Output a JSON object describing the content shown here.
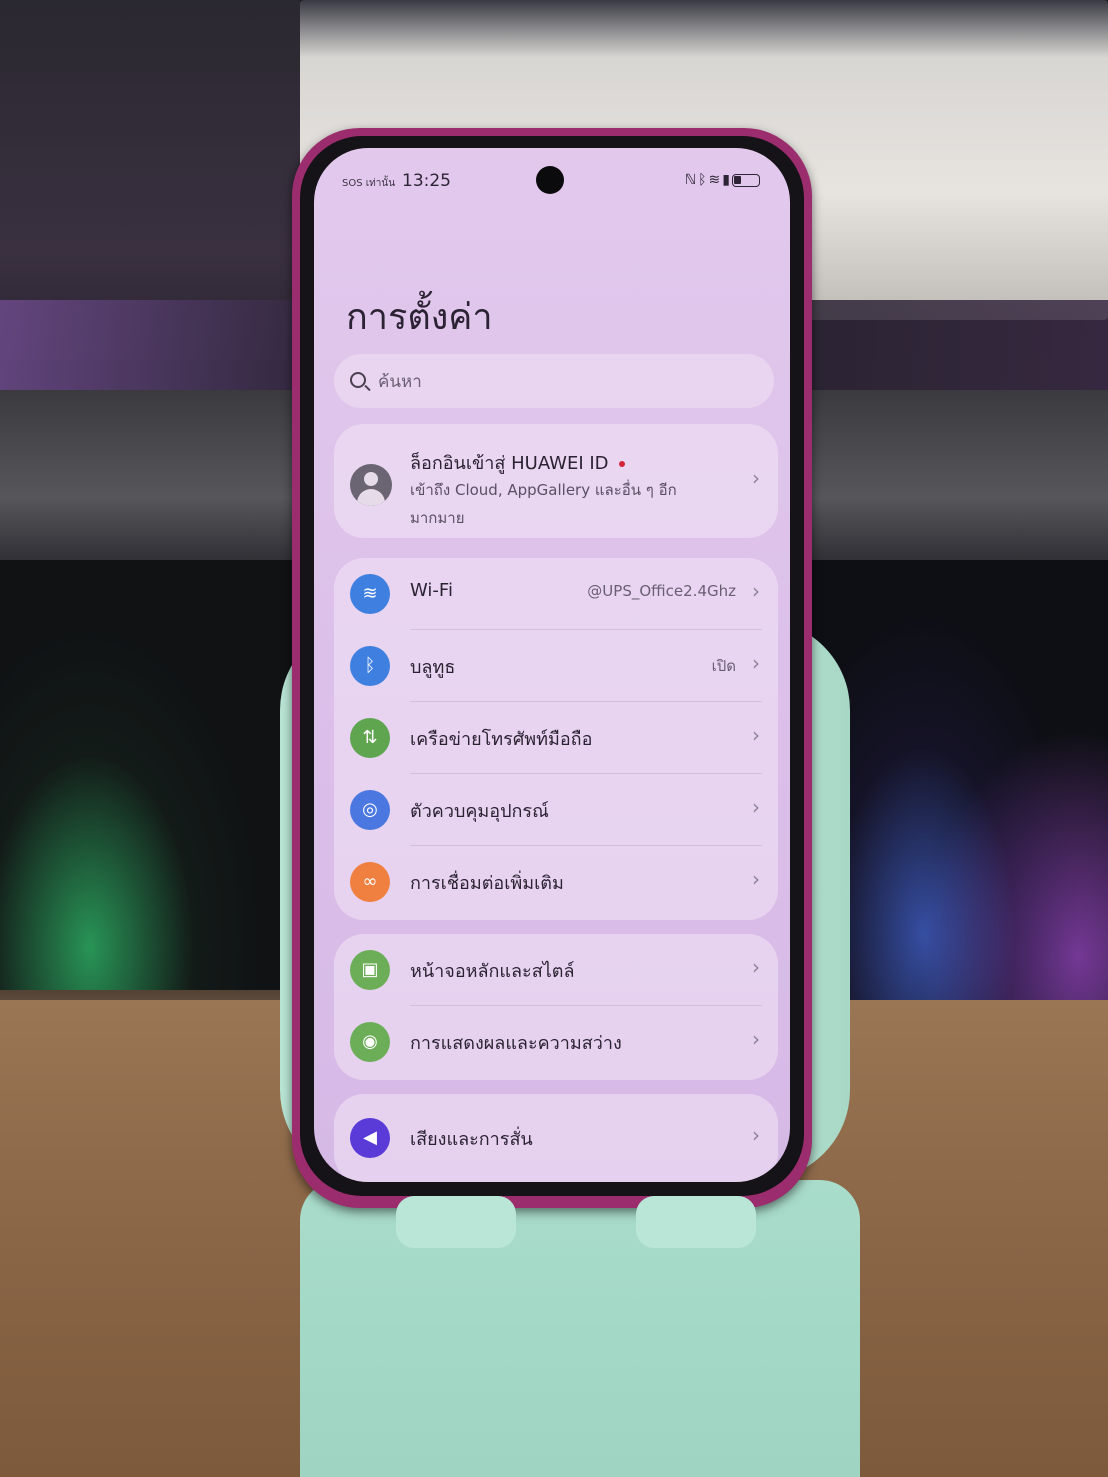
{
  "status_bar": {
    "carrier": "SOS เท่านั้น",
    "time": "13:25",
    "indicator_icons": [
      "nfc-icon",
      "bluetooth-icon",
      "wifi-icon",
      "vibrate-icon",
      "battery-icon"
    ]
  },
  "page": {
    "title": "การตั้งค่า"
  },
  "search": {
    "placeholder": "ค้นหา"
  },
  "account": {
    "title": "ล็อกอินเข้าสู่ HUAWEI ID",
    "subtitle": "เข้าถึง Cloud, AppGallery และอื่น ๆ อีกมากมาย",
    "notification_dot_color": "#d4233a"
  },
  "groups": [
    {
      "items": [
        {
          "label": "Wi-Fi",
          "value": "@UPS_Office2.4Ghz",
          "icon": "wifi-icon",
          "color": "#3f7fe0"
        },
        {
          "label": "บลูทูธ",
          "value": "เปิด",
          "icon": "bluetooth-icon",
          "color": "#3f7fe0"
        },
        {
          "label": "เครือข่ายโทรศัพท์มือถือ",
          "value": "",
          "icon": "mobile-network-icon",
          "color": "#5fa550"
        },
        {
          "label": "ตัวควบคุมอุปกรณ์",
          "value": "",
          "icon": "device-control-icon",
          "color": "#4a78e0"
        },
        {
          "label": "การเชื่อมต่อเพิ่มเติม",
          "value": "",
          "icon": "link-icon",
          "color": "#f08040"
        }
      ]
    },
    {
      "items": [
        {
          "label": "หน้าจอหลักและสไตล์",
          "value": "",
          "icon": "wallpaper-icon",
          "color": "#6cae58"
        },
        {
          "label": "การแสดงผลและความสว่าง",
          "value": "",
          "icon": "eye-icon",
          "color": "#6cae58"
        }
      ]
    },
    {
      "items": [
        {
          "label": "เสียงและการสั่น",
          "value": "",
          "icon": "speaker-icon",
          "color": "#5b3bd8"
        }
      ]
    }
  ]
}
